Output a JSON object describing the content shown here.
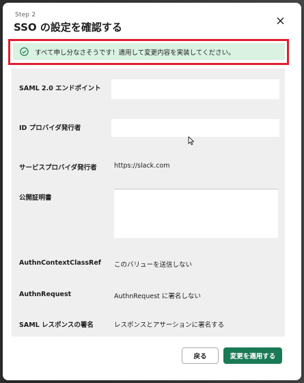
{
  "modal": {
    "step": "Step 2",
    "title": "SSO の設定を確認する",
    "close_icon": "close-x-icon"
  },
  "banner": {
    "icon": "check-circle-icon",
    "message": "すべて申し分なさそうです！適用して変更内容を実装してください。",
    "color": "#d9f2e2"
  },
  "rows": {
    "saml_endpoint": {
      "label": "SAML 2.0 エンドポイント",
      "value": ""
    },
    "idp_issuer": {
      "label": "ID プロバイダ発行者",
      "value": ""
    },
    "sp_issuer": {
      "label": "サービスプロバイダ発行者",
      "value": "https://slack.com"
    },
    "public_cert": {
      "label": "公開証明書",
      "value": ""
    },
    "authn_context": {
      "label": "AuthnContextClassRef",
      "value": "このバリューを送信しない"
    },
    "authn_request": {
      "label": "AuthnRequest",
      "value": "AuthnRequest に署名しない"
    },
    "saml_response": {
      "label": "SAML レスポンスの署名",
      "value": "レスポンスとアサーションに署名する"
    }
  },
  "footer": {
    "back_label": "戻る",
    "apply_label": "変更を適用する",
    "apply_color": "#1a7a56"
  },
  "highlight_color": "#e01e2e"
}
